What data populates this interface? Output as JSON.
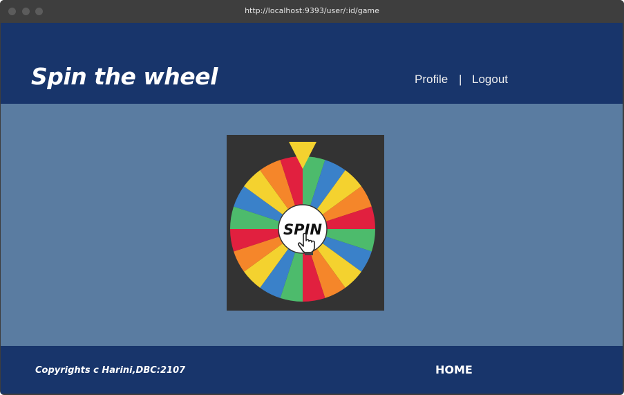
{
  "browser": {
    "url": "http://localhost:9393/user/:id/game"
  },
  "header": {
    "title": "Spin the wheel",
    "nav": {
      "profile_label": "Profile",
      "separator": "|",
      "logout_label": "Logout"
    }
  },
  "wheel": {
    "button_label": "SPIN",
    "segment_colors": [
      "#4dbb6c",
      "#3a81c9",
      "#f4d22f",
      "#f5862a",
      "#e1203f"
    ],
    "pointer_color": "#f4d22f",
    "background_color": "#333333"
  },
  "footer": {
    "copyright": "Copyrights c Harini,DBC:2107",
    "home_label": "HOME"
  },
  "colors": {
    "header_bg": "#18356b",
    "main_bg": "#5a7ca1"
  }
}
